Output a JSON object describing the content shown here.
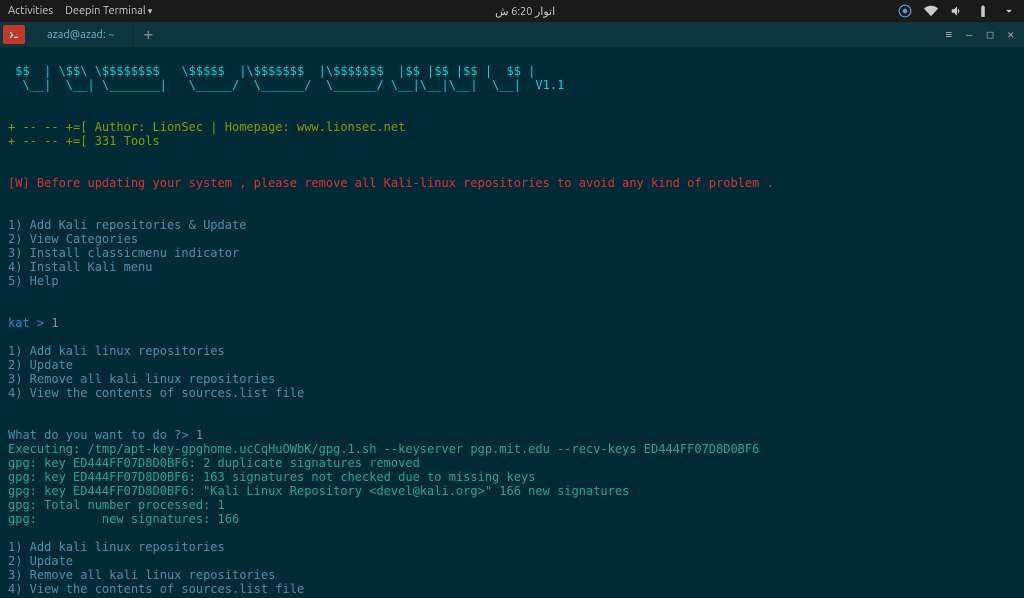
{
  "topbar": {
    "activities": "Activities",
    "app_menu": "Deepin Terminal",
    "clock": "اتوار 6:20 ش"
  },
  "tabbar": {
    "tab_title": "azad@azad: ~"
  },
  "ascii": {
    "l1": " $$  | \\$$\\ \\$$$$$$$$   \\$$$$$  |\\$$$$$$$  |\\$$$$$$$  |$$ |$$ |$$ |  $$ |",
    "l2": "  \\__|  \\__| \\_______|   \\_____/  \\______/  \\______/ \\__|\\__|\\__|  \\__|  V1.1"
  },
  "header": {
    "author_line": "+ -- -- +=[ Author: LionSec | Homepage: www.lionsec.net",
    "tools_line": "+ -- -- +=[ 331 Tools"
  },
  "warning": "[W] Before updating your system , please remove all Kali-linux repositories to avoid any kind of problem .",
  "menu1": {
    "i1": "1) Add Kali repositories & Update",
    "i2": "2) View Categories",
    "i3": "3) Install classicmenu indicator",
    "i4": "4) Install Kali menu",
    "i5": "5) Help"
  },
  "prompt1": {
    "prefix": "kat > ",
    "input": "1"
  },
  "submenu": {
    "i1": "1) Add kali linux repositories",
    "i2": "2) Update",
    "i3": "3) Remove all kali linux repositories",
    "i4": "4) View the contents of sources.list file"
  },
  "prompt2": {
    "prefix": "What do you want to do ?> ",
    "input": "1"
  },
  "exec": {
    "l1": "Executing: /tmp/apt-key-gpghome.ucCqHuOWbK/gpg.1.sh --keyserver pgp.mit.edu --recv-keys ED444FF07D8D0BF6",
    "l2": "gpg: key ED444FF07D8D0BF6: 2 duplicate signatures removed",
    "l3": "gpg: key ED444FF07D8D0BF6: 163 signatures not checked due to missing keys",
    "l4": "gpg: key ED444FF07D8D0BF6: \"Kali Linux Repository <devel@kali.org>\" 166 new signatures",
    "l5": "gpg: Total number processed: 1",
    "l6": "gpg:         new signatures: 166"
  },
  "submenu2": {
    "i1": "1) Add kali linux repositories",
    "i2": "2) Update",
    "i3": "3) Remove all kali linux repositories",
    "i4": "4) View the contents of sources.list file"
  }
}
